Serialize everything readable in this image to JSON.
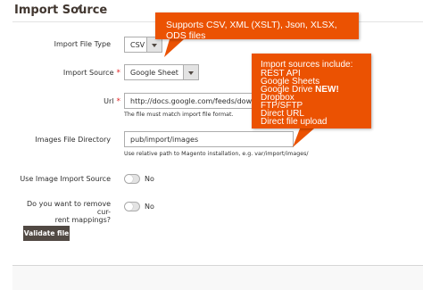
{
  "header": {
    "title": "Import Source",
    "edit_icon": "pencil-icon"
  },
  "form": {
    "file_type": {
      "label": "Import File Type",
      "value": "CSV"
    },
    "source": {
      "label": "Import Source",
      "value": "Google Sheet",
      "required": "*"
    },
    "url": {
      "label": "Url",
      "value": "http://docs.google.com/feeds/download/sp",
      "note": "The file must match import file format.",
      "required": "*"
    },
    "images_dir": {
      "label": "Images File Directory",
      "value": "pub/import/images",
      "note": "Use relative path to Magento installation, e.g. var/import/images/"
    },
    "image_source": {
      "label": "Use Image Import Source",
      "toggle_text": "No"
    },
    "remove_mappings": {
      "label_line1": "Do you want to remove cur-",
      "label_line2": "rent mappings?",
      "toggle_text": "No"
    },
    "validate_button": "Validate file"
  },
  "callouts": {
    "formats": "Supports CSV, XML (XSLT), Json, XLSX, ODS files",
    "sources_title": "Import sources include:",
    "sources": [
      "REST API",
      "Google Sheets",
      "Google Drive",
      "Dropbox",
      "FTP/SFTP",
      "Direct URL",
      "Direct file upload"
    ],
    "new_badge": "NEW!"
  },
  "colors": {
    "callout": "#eb5202",
    "button": "#514943",
    "required": "#e22626"
  }
}
